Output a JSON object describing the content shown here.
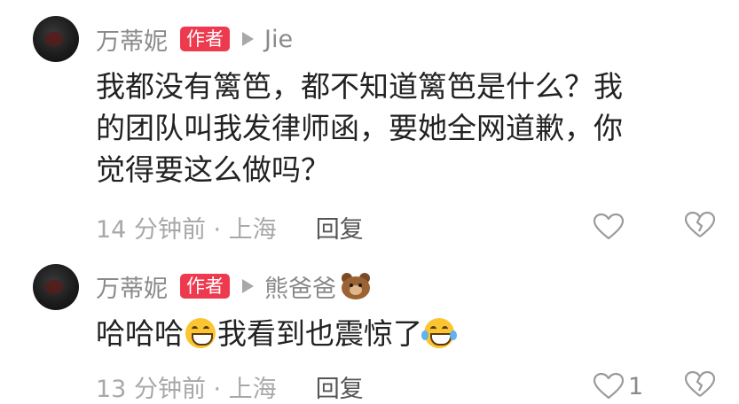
{
  "comments": [
    {
      "username": "万蒂妮",
      "badge": "作者",
      "reply_to": "Jie",
      "text_lines": [
        "我都没有篱笆，都不知道篱笆是什么？我",
        "的团队叫我发律师函，要她全网道歉，你",
        "觉得要这么做吗？"
      ],
      "time_location": "14 分钟前 · 上海",
      "reply_label": "回复",
      "like_count": ""
    },
    {
      "username": "万蒂妮",
      "badge": "作者",
      "reply_to": "熊爸爸",
      "reply_to_icon": "bear-face-icon",
      "text_parts": [
        "哈哈哈",
        "我看到也震惊了"
      ],
      "emojis": [
        "grinning-face-icon",
        "laughing-tears-icon"
      ],
      "time_location": "13 分钟前 · 上海",
      "reply_label": "回复",
      "like_count": "1"
    }
  ],
  "colors": {
    "badge_bg": "#ee3a4e",
    "username": "#8a8a8a",
    "body_text": "#222222",
    "meta_text": "#a8a8a8"
  }
}
